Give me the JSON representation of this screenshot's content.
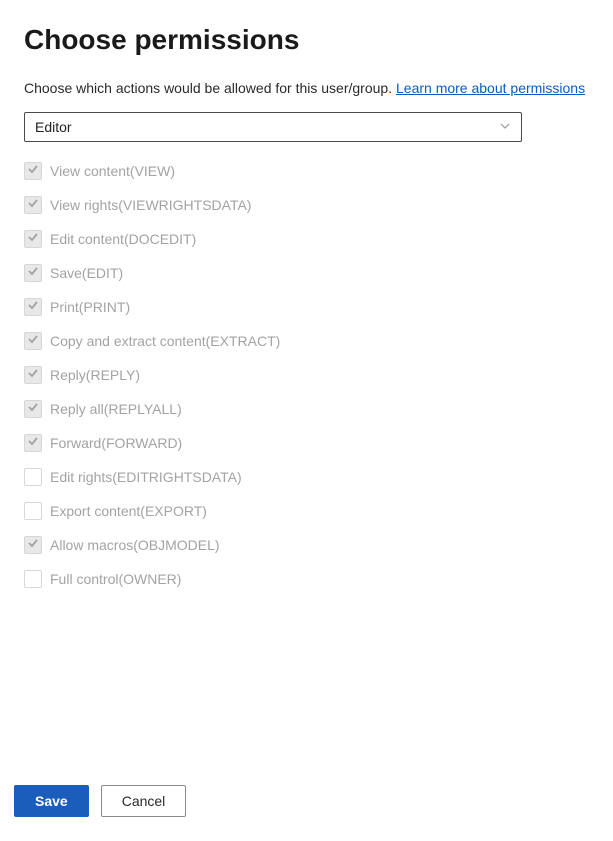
{
  "title": "Choose permissions",
  "subtitle": "Choose which actions would be allowed for this user/group.",
  "learn_more": "Learn more about permissions",
  "dropdown": {
    "selected": "Editor"
  },
  "permissions": [
    {
      "label": "View content(VIEW)",
      "checked": true
    },
    {
      "label": "View rights(VIEWRIGHTSDATA)",
      "checked": true
    },
    {
      "label": "Edit content(DOCEDIT)",
      "checked": true
    },
    {
      "label": "Save(EDIT)",
      "checked": true
    },
    {
      "label": "Print(PRINT)",
      "checked": true
    },
    {
      "label": "Copy and extract content(EXTRACT)",
      "checked": true
    },
    {
      "label": "Reply(REPLY)",
      "checked": true
    },
    {
      "label": "Reply all(REPLYALL)",
      "checked": true
    },
    {
      "label": "Forward(FORWARD)",
      "checked": true
    },
    {
      "label": "Edit rights(EDITRIGHTSDATA)",
      "checked": false
    },
    {
      "label": "Export content(EXPORT)",
      "checked": false
    },
    {
      "label": "Allow macros(OBJMODEL)",
      "checked": true
    },
    {
      "label": "Full control(OWNER)",
      "checked": false
    }
  ],
  "buttons": {
    "save": "Save",
    "cancel": "Cancel"
  }
}
